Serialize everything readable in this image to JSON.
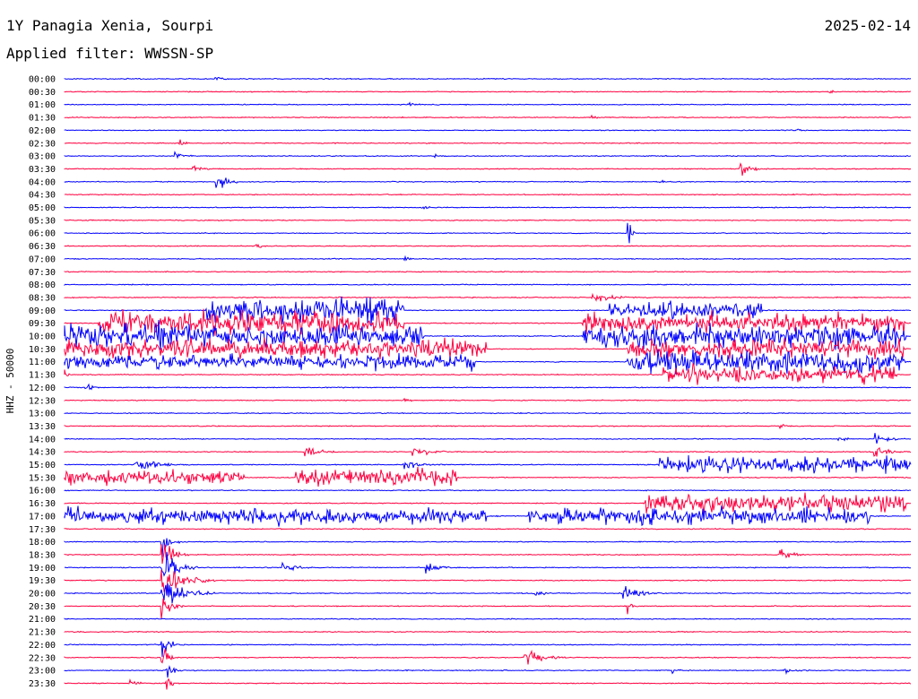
{
  "header": {
    "station": "1Y Panagia Xenia, Sourpi",
    "date": "2025-02-14",
    "filter": "Applied filter: WWSSN-SP"
  },
  "chart_data": {
    "type": "line",
    "ylabel": "HHZ - 50000",
    "colors": {
      "even_row": "#0000ff",
      "odd_row": "#ff0040"
    },
    "rows": [
      "00:00",
      "00:30",
      "01:00",
      "01:30",
      "02:00",
      "02:30",
      "03:00",
      "03:30",
      "04:00",
      "04:30",
      "05:00",
      "05:30",
      "06:00",
      "06:30",
      "07:00",
      "07:30",
      "08:00",
      "08:30",
      "09:00",
      "09:30",
      "10:00",
      "10:30",
      "11:00",
      "11:30",
      "12:00",
      "12:30",
      "13:00",
      "13:30",
      "14:00",
      "14:30",
      "15:00",
      "15:30",
      "16:00",
      "16:30",
      "17:00",
      "17:30",
      "18:00",
      "18:30",
      "19:00",
      "19:30",
      "20:00",
      "20:30",
      "21:00",
      "21:30",
      "22:00",
      "22:30",
      "23:00",
      "23:30"
    ]
  }
}
